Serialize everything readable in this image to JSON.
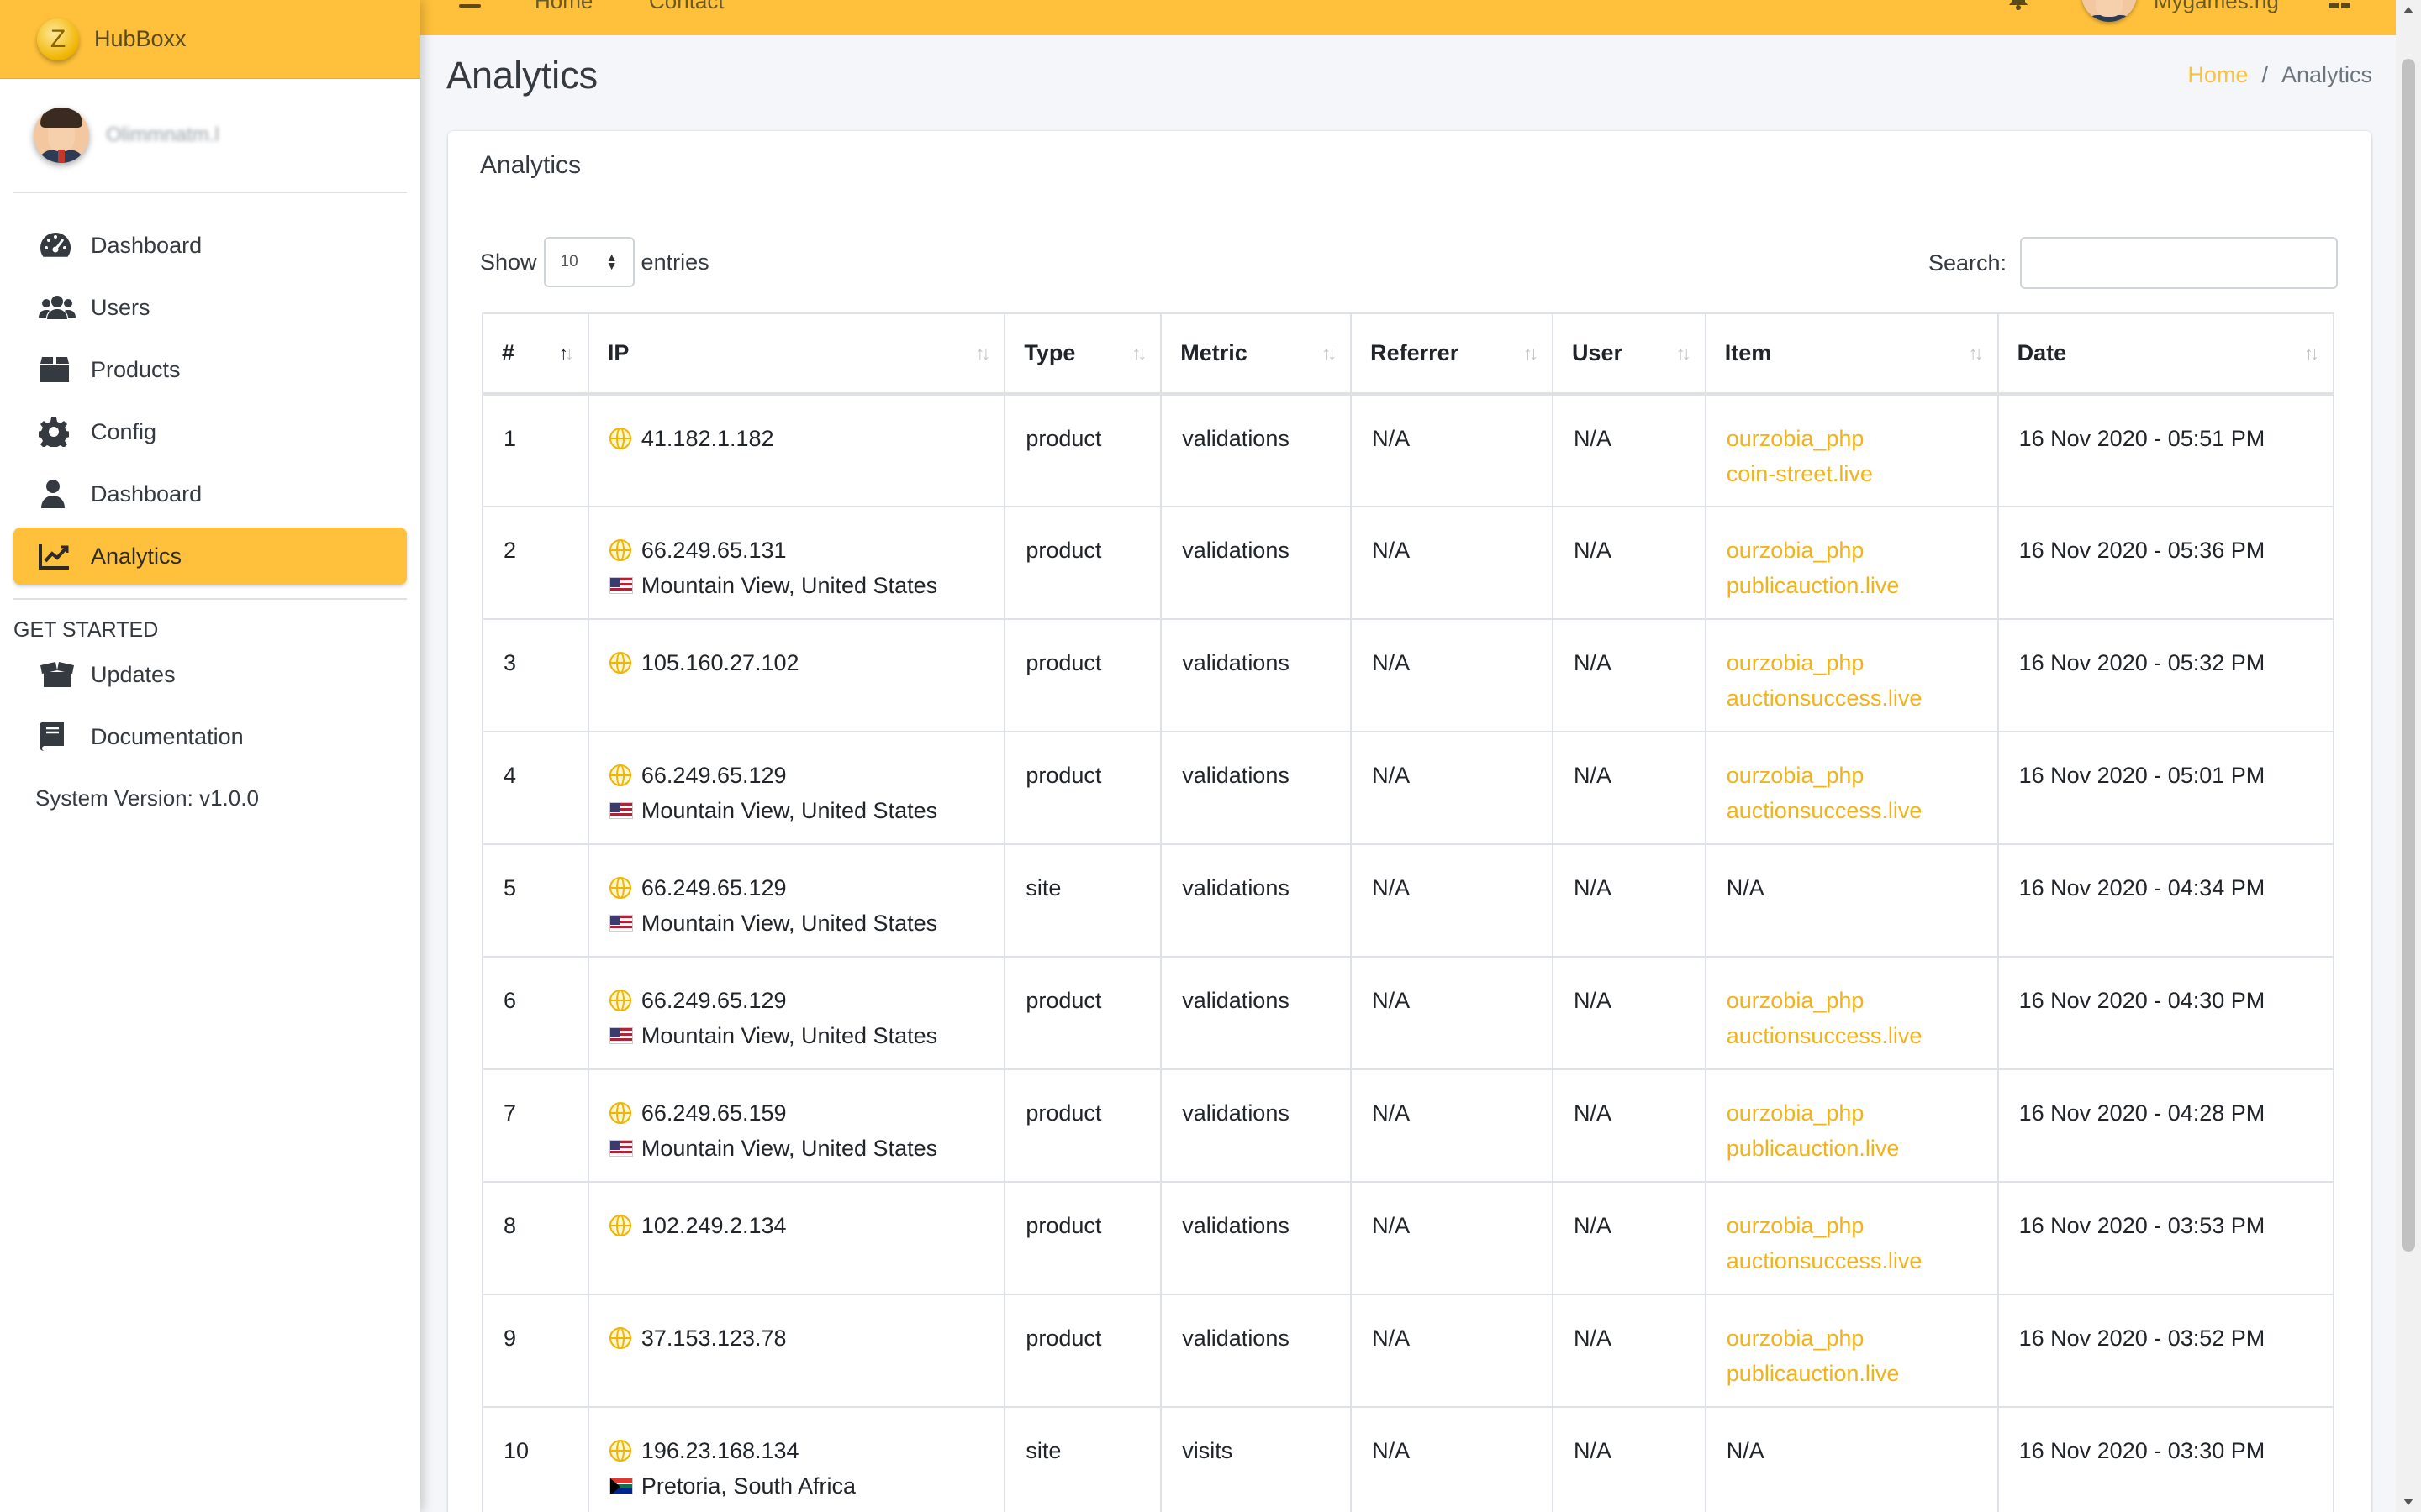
{
  "brand": {
    "logo_letter": "Z",
    "name": "HubBoxx"
  },
  "user": {
    "name": "Olimmnatm.l"
  },
  "nav": {
    "items": [
      {
        "label": "Dashboard",
        "icon": "tachometer-icon",
        "active": false
      },
      {
        "label": "Users",
        "icon": "users-icon",
        "active": false
      },
      {
        "label": "Products",
        "icon": "box-icon",
        "active": false
      },
      {
        "label": "Config",
        "icon": "gear-icon",
        "active": false
      },
      {
        "label": "Dashboard",
        "icon": "user-icon",
        "active": false
      },
      {
        "label": "Analytics",
        "icon": "chart-line-icon",
        "active": true
      }
    ],
    "header": "GET STARTED",
    "items2": [
      {
        "label": "Updates",
        "icon": "box-open-icon"
      },
      {
        "label": "Documentation",
        "icon": "book-icon"
      }
    ],
    "version": "System Version: v1.0.0"
  },
  "topbar": {
    "home": "Home",
    "contact": "Contact",
    "username": "Mygames.ng"
  },
  "page": {
    "title": "Analytics",
    "breadcrumb": {
      "home": "Home",
      "sep": "/",
      "current": "Analytics"
    }
  },
  "card": {
    "title": "Analytics",
    "length": {
      "show": "Show",
      "value": "10",
      "entries": "entries"
    },
    "search_label": "Search:",
    "search_value": ""
  },
  "table": {
    "headers": [
      "#",
      "IP",
      "Type",
      "Metric",
      "Referrer",
      "User",
      "Item",
      "Date"
    ],
    "rows": [
      {
        "n": "1",
        "ip": "41.182.1.182",
        "loc": "",
        "flag": "",
        "type": "product",
        "metric": "validations",
        "referrer": "N/A",
        "user": "N/A",
        "item1": "ourzobia_php",
        "item2": "coin-street.live",
        "date": "16 Nov 2020 - 05:51 PM"
      },
      {
        "n": "2",
        "ip": "66.249.65.131",
        "loc": "Mountain View, United States",
        "flag": "us",
        "type": "product",
        "metric": "validations",
        "referrer": "N/A",
        "user": "N/A",
        "item1": "ourzobia_php",
        "item2": "publicauction.live",
        "date": "16 Nov 2020 - 05:36 PM"
      },
      {
        "n": "3",
        "ip": "105.160.27.102",
        "loc": "",
        "flag": "",
        "type": "product",
        "metric": "validations",
        "referrer": "N/A",
        "user": "N/A",
        "item1": "ourzobia_php",
        "item2": "auctionsuccess.live",
        "date": "16 Nov 2020 - 05:32 PM"
      },
      {
        "n": "4",
        "ip": "66.249.65.129",
        "loc": "Mountain View, United States",
        "flag": "us",
        "type": "product",
        "metric": "validations",
        "referrer": "N/A",
        "user": "N/A",
        "item1": "ourzobia_php",
        "item2": "auctionsuccess.live",
        "date": "16 Nov 2020 - 05:01 PM"
      },
      {
        "n": "5",
        "ip": "66.249.65.129",
        "loc": "Mountain View, United States",
        "flag": "us",
        "type": "site",
        "metric": "validations",
        "referrer": "N/A",
        "user": "N/A",
        "item1": "N/A",
        "item2": "",
        "date": "16 Nov 2020 - 04:34 PM"
      },
      {
        "n": "6",
        "ip": "66.249.65.129",
        "loc": "Mountain View, United States",
        "flag": "us",
        "type": "product",
        "metric": "validations",
        "referrer": "N/A",
        "user": "N/A",
        "item1": "ourzobia_php",
        "item2": "auctionsuccess.live",
        "date": "16 Nov 2020 - 04:30 PM"
      },
      {
        "n": "7",
        "ip": "66.249.65.159",
        "loc": "Mountain View, United States",
        "flag": "us",
        "type": "product",
        "metric": "validations",
        "referrer": "N/A",
        "user": "N/A",
        "item1": "ourzobia_php",
        "item2": "publicauction.live",
        "date": "16 Nov 2020 - 04:28 PM"
      },
      {
        "n": "8",
        "ip": "102.249.2.134",
        "loc": "",
        "flag": "",
        "type": "product",
        "metric": "validations",
        "referrer": "N/A",
        "user": "N/A",
        "item1": "ourzobia_php",
        "item2": "auctionsuccess.live",
        "date": "16 Nov 2020 - 03:53 PM"
      },
      {
        "n": "9",
        "ip": "37.153.123.78",
        "loc": "",
        "flag": "",
        "type": "product",
        "metric": "validations",
        "referrer": "N/A",
        "user": "N/A",
        "item1": "ourzobia_php",
        "item2": "publicauction.live",
        "date": "16 Nov 2020 - 03:52 PM"
      },
      {
        "n": "10",
        "ip": "196.23.168.134",
        "loc": "Pretoria, South Africa",
        "flag": "za",
        "type": "site",
        "metric": "visits",
        "referrer": "N/A",
        "user": "N/A",
        "item1": "N/A",
        "item2": "",
        "date": "16 Nov 2020 - 03:30 PM"
      }
    ]
  },
  "colors": {
    "accent": "#ffc13b",
    "link": "#f2b31a"
  }
}
